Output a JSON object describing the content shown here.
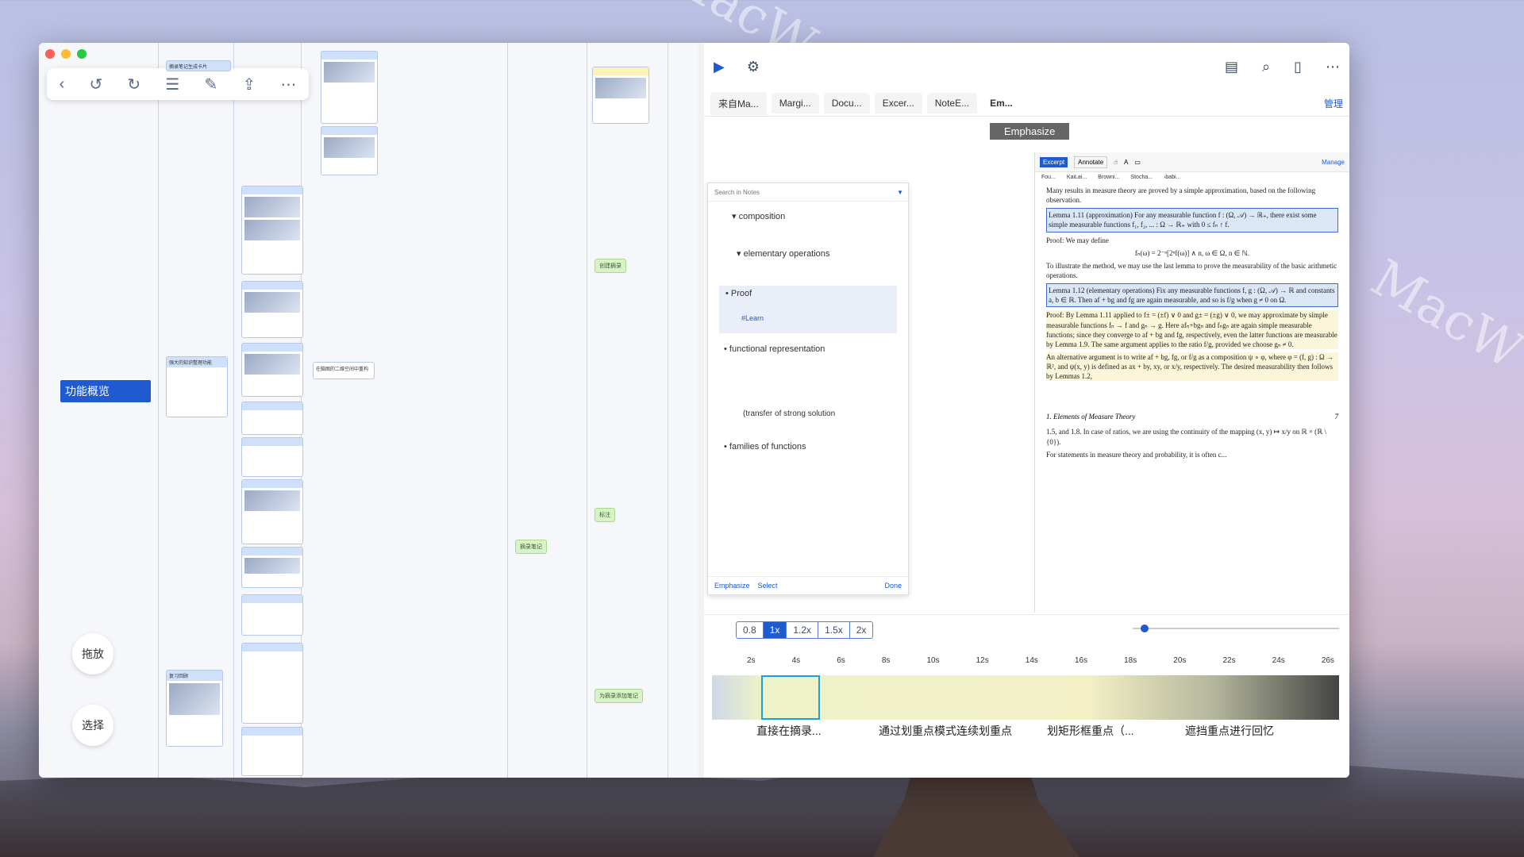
{
  "mindmap": {
    "main_node": "功能概览",
    "drag_button": "拖放",
    "select_button": "选择",
    "link_label_1": "在脑图的二维空间中重构",
    "nodes_left": [
      "摘录笔记生成卡片",
      "强大的知识整理功能",
      "复习回顾"
    ],
    "nodes_green": [
      "创建摘录",
      "标注",
      "摘录笔记",
      "为摘录添加笔记"
    ]
  },
  "right_panel": {
    "tabs": [
      "来自Ma...",
      "Margi...",
      "Docu...",
      "Excer...",
      "NoteE...",
      "Em..."
    ],
    "manage_label": "管理",
    "emphasize_tag": "Emphasize",
    "notes": {
      "search_placeholder": "Search in Notes",
      "items": [
        "composition",
        "elementary operations",
        "Proof",
        "functional representation",
        "families of functions"
      ],
      "learn_tag": "#Learn",
      "handwriting_caption": "(transfer of strong solution",
      "bottom_actions": [
        "Emphasize",
        "Select",
        "Done"
      ]
    },
    "pdf": {
      "toolbar_tabs": [
        "Excerpt",
        "Annotate"
      ],
      "manage": "Manage",
      "mini_tabs": [
        "Fou...",
        "KaiLai...",
        "Browni...",
        "Stocha...",
        "›babi..."
      ],
      "para_1": "Many results in measure theory are proved by a simple approximation, based on the following observation.",
      "lemma_1": "Lemma 1.11 (approximation) For any measurable function f : (Ω, 𝒜) → ℝ₊, there exist some simple measurable functions f₁, f₂, ... : Ω → ℝ₊ with 0 ≤ fₙ ↑ f.",
      "proof_1": "Proof: We may define",
      "formula": "fₙ(ω) = 2⁻ⁿ[2ⁿf(ω)] ∧ n,   ω ∈ Ω, n ∈ ℕ.",
      "para_2": "To illustrate the method, we may use the last lemma to prove the measurability of the basic arithmetic operations.",
      "lemma_2": "Lemma 1.12 (elementary operations) Fix any measurable functions f, g : (Ω, 𝒜) → ℝ and constants a, b ∈ ℝ. Then af + bg and fg are again measurable, and so is f/g when g ≠ 0 on Ω.",
      "proof_2": "Proof: By Lemma 1.11 applied to f± = (±f) ∨ 0 and g± = (±g) ∨ 0, we may approximate by simple measurable functions fₙ → f and gₙ → g. Here afₙ+bgₙ and fₙgₙ are again simple measurable functions; since they converge to af + bg and fg, respectively, even the latter functions are measurable by Lemma 1.9. The same argument applies to the ratio f/g, provided we choose gₙ ≠ 0.",
      "para_3": "An alternative argument is to write af + bg, fg, or f/g as a composition ψ ∘ φ, where φ = (f, g) : Ω → ℝ², and ψ(x, y) is defined as ax + by, xy, or x/y, respectively. The desired measurability then follows by Lemmas 1.2,",
      "footer_title": "1. Elements of Measure Theory",
      "page_num": "7",
      "para_4": "1.5, and 1.8. In case of ratios, we are using the continuity of the mapping (x, y) ↦ x/y on ℝ × (ℝ \\ {0}).",
      "para_5": "For statements in measure theory and probability, it is often c..."
    },
    "timeline": {
      "speeds": [
        "0.8",
        "1x",
        "1.2x",
        "1.5x",
        "2x"
      ],
      "active_speed": "1x",
      "ticks": [
        "2s",
        "4s",
        "6s",
        "8s",
        "10s",
        "12s",
        "14s",
        "16s",
        "18s",
        "20s",
        "22s",
        "24s",
        "26s"
      ],
      "clips": [
        "直接在摘录...",
        "通过划重点模式连续划重点",
        "划矩形框重点（...",
        "遮挡重点进行回忆"
      ]
    }
  }
}
